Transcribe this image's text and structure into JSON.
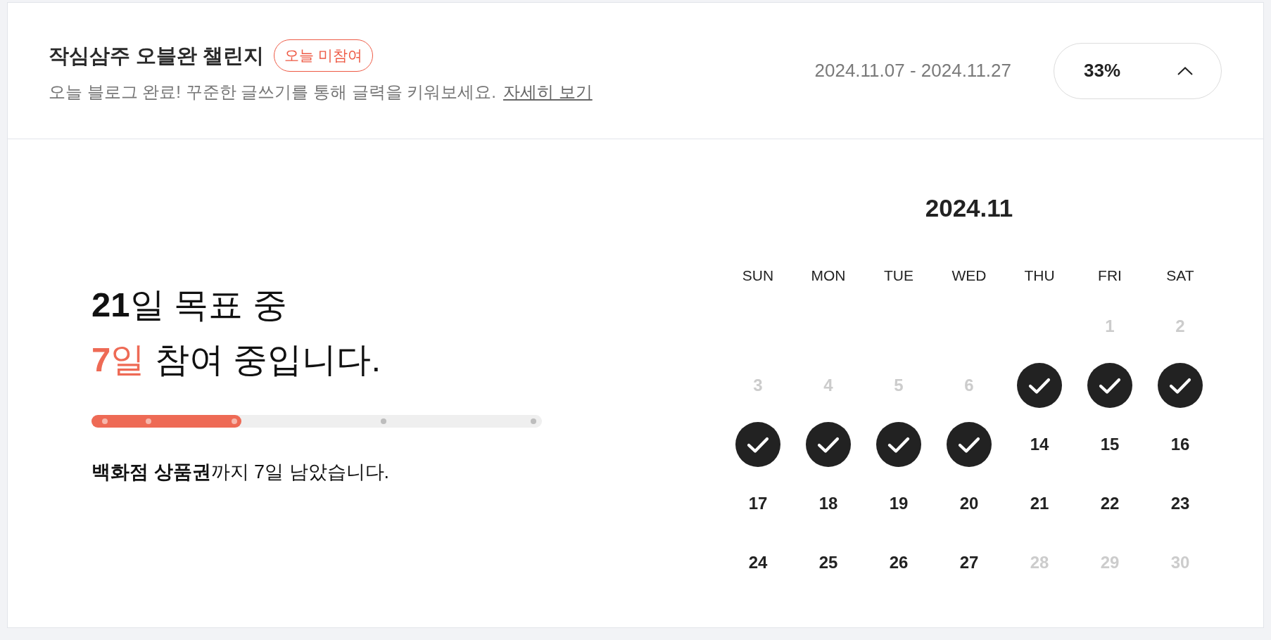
{
  "challenge": {
    "title": "작심삼주 오블완 챌린지",
    "badge": "오늘 미참여",
    "description": "오늘 블로그 완료! 꾸준한 글쓰기를 통해 글력을 키워보세요.",
    "link": "자세히 보기",
    "period": "2024.11.07 - 2024.11.27",
    "toggle": {
      "label": "33%",
      "expanded": true
    }
  },
  "summary": {
    "headline_1": "**21**일 목표 중",
    "headline_2_highlight": "**7**일",
    "headline_2_rest": "참여 중입니다.",
    "progress": {
      "level": 0.333,
      "milestones": [
        {
          "level": 0.03
        },
        {
          "level": 0.126
        },
        {
          "level": 0.317
        },
        {
          "level": 0.649
        },
        {
          "level": 0.982
        }
      ]
    },
    "reward_note": "**백화점 상품권**까지 7일 남았습니다."
  },
  "calendar": {
    "title": "2024.11",
    "weekdays": [
      "SUN",
      "MON",
      "TUE",
      "WED",
      "THU",
      "FRI",
      "SAT"
    ],
    "weeks": [
      [
        {
          "label": "1",
          "checked": false,
          "muted": true
        },
        {
          "label": "2",
          "checked": false,
          "muted": true
        }
      ],
      [
        {
          "label": "3",
          "checked": false,
          "muted": true
        },
        {
          "label": "4",
          "checked": false,
          "muted": true
        },
        {
          "label": "5",
          "checked": false,
          "muted": true
        },
        {
          "label": "6",
          "checked": false,
          "muted": true
        },
        {
          "checked": true,
          "muted": false
        },
        {
          "checked": true,
          "muted": false
        },
        {
          "checked": true,
          "muted": false
        }
      ],
      [
        {
          "checked": true,
          "muted": false
        },
        {
          "checked": true,
          "muted": false
        },
        {
          "checked": true,
          "muted": false
        },
        {
          "checked": true,
          "muted": false
        },
        {
          "label": "14",
          "checked": false,
          "muted": false
        },
        {
          "label": "15",
          "checked": false,
          "muted": false
        },
        {
          "label": "16",
          "checked": false,
          "muted": false
        }
      ],
      [
        {
          "label": "17",
          "checked": false,
          "muted": false
        },
        {
          "label": "18",
          "checked": false,
          "muted": false
        },
        {
          "label": "19",
          "checked": false,
          "muted": false
        },
        {
          "label": "20",
          "checked": false,
          "muted": false
        },
        {
          "label": "21",
          "checked": false,
          "muted": false
        },
        {
          "label": "22",
          "checked": false,
          "muted": false
        },
        {
          "label": "23",
          "checked": false,
          "muted": false
        }
      ],
      [
        {
          "label": "24",
          "checked": false,
          "muted": false
        },
        {
          "label": "25",
          "checked": false,
          "muted": false
        },
        {
          "label": "26",
          "checked": false,
          "muted": false
        },
        {
          "label": "27",
          "checked": false,
          "muted": false
        },
        {
          "label": "28",
          "checked": false,
          "muted": true
        },
        {
          "label": "29",
          "checked": false,
          "muted": true
        },
        {
          "label": "30",
          "checked": false,
          "muted": true
        }
      ]
    ]
  }
}
